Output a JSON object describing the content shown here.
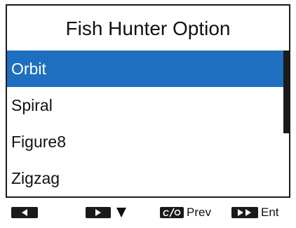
{
  "title": "Fish Hunter Option",
  "menu": {
    "selected_index": 0,
    "items": [
      {
        "label": "Orbit"
      },
      {
        "label": "Spiral"
      },
      {
        "label": "Figure8"
      },
      {
        "label": "Zigzag"
      }
    ]
  },
  "scrollbar": {
    "visible_fraction": 0.57
  },
  "softkeys": {
    "left": {
      "icon": "left-arrow-key-icon"
    },
    "down": {
      "icon": "right-arrow-down-key-icon"
    },
    "prev": {
      "icon": "clear-key-icon",
      "label": "Prev"
    },
    "enter": {
      "icon": "double-arrow-key-icon",
      "label": "Ent"
    }
  },
  "colors": {
    "selection": "#1e6fbf",
    "text": "#111111",
    "frame": "#1a1a1a"
  }
}
